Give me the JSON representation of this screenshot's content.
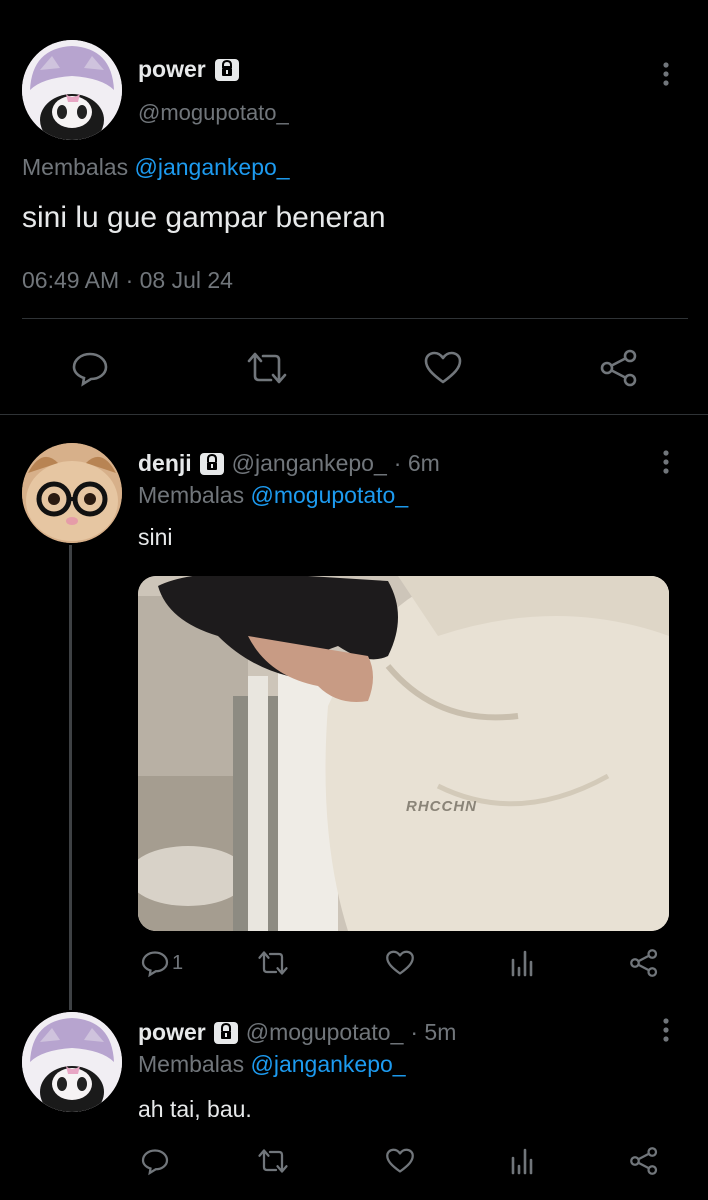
{
  "main_tweet": {
    "display_name": "power",
    "handle": "@mogupotato_",
    "reply_prefix": "Membalas",
    "reply_to": "@jangankepo_",
    "text": "sini lu gue gampar beneran",
    "timestamp": "06:49 AM · 08 Jul 24",
    "icons": [
      "reply-icon",
      "retweet-icon",
      "like-icon",
      "share-icon"
    ]
  },
  "reply1": {
    "display_name": "denji",
    "handle": "@jangankepo_",
    "time": "· 6m",
    "reply_prefix": "Membalas",
    "reply_to": "@mogupotato_",
    "text": "sini",
    "media_text": "RHCCHN",
    "reply_count": "1"
  },
  "reply2": {
    "display_name": "power",
    "handle": "@mogupotato_",
    "time": "· 5m",
    "reply_prefix": "Membalas",
    "reply_to": "@jangankepo_",
    "text": "ah tai, bau."
  },
  "colors": {
    "background": "#000000",
    "text": "#e7e9ea",
    "muted": "#71767b",
    "link": "#1d9bf0",
    "divider": "#2f3336"
  }
}
